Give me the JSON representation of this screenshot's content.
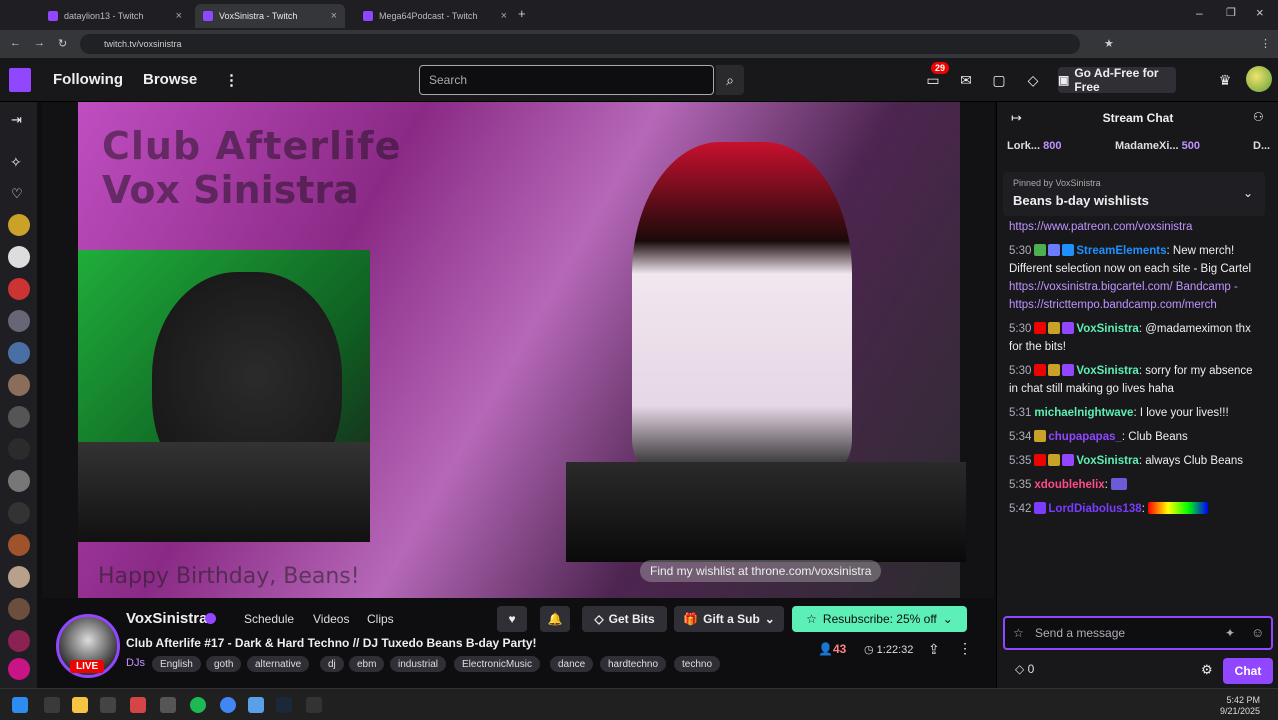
{
  "browser": {
    "tabs": [
      {
        "title": "dataylion13 - Twitch",
        "active": false
      },
      {
        "title": "VoxSinistra - Twitch",
        "active": true
      },
      {
        "title": "Mega64Podcast - Twitch",
        "active": false
      }
    ],
    "url": "twitch.tv/voxsinistra"
  },
  "topnav": {
    "following": "Following",
    "browse": "Browse",
    "search_placeholder": "Search",
    "notification_count": "29",
    "adfree_label": "Go Ad-Free for Free"
  },
  "video": {
    "overlay_title_line1": "Club Afterlife",
    "overlay_title_line2": "Vox Sinistra",
    "overlay_bottom": "Happy Birthday, Beans!",
    "wishlist_text": "Find my wishlist at throne.com/voxsinistra"
  },
  "channel": {
    "name": "VoxSinistra",
    "live_label": "LIVE",
    "tabs": [
      "Schedule",
      "Videos",
      "Clips"
    ],
    "title": "Club Afterlife #17 - Dark & Hard Techno // DJ Tuxedo Beans B-day Party!",
    "category": "DJs",
    "tags": [
      "English",
      "goth",
      "alternative",
      "dj",
      "ebm",
      "industrial",
      "ElectronicMusic",
      "dance",
      "hardtechno",
      "techno"
    ],
    "get_bits": "Get Bits",
    "gift_sub": "Gift a Sub",
    "resubscribe": "Resubscribe: 25% off",
    "viewers": "43",
    "uptime": "1:22:32"
  },
  "chat": {
    "header": "Stream Chat",
    "leaderboard": [
      {
        "name": "Lork...",
        "amount": "800"
      },
      {
        "name": "MadameXi...",
        "amount": "500"
      },
      {
        "name": "D...",
        "amount": ""
      }
    ],
    "pinned_by_label": "Pinned by",
    "pinned_by_user": "VoxSinistra",
    "pinned_text": "Beans b-day wishlists",
    "messages": [
      {
        "time": "",
        "user": "",
        "color": "#bf94ff",
        "text": "",
        "link": "https://www.patreon.com/voxsinistra"
      },
      {
        "time": "5:30",
        "user": "StreamElements",
        "color": "#1e90ff",
        "text": "New merch! Different selection now on each site - Big Cartel",
        "link": "https://voxsinistra.bigcartel.com/ Bandcamp - https://stricttempo.bandcamp.com/merch"
      },
      {
        "time": "5:30",
        "user": "VoxSinistra",
        "color": "#5cf0b6",
        "text": "@madameximon thx for the bits!",
        "link": ""
      },
      {
        "time": "5:30",
        "user": "VoxSinistra",
        "color": "#5cf0b6",
        "text": "sorry for my absence in chat still making go lives haha",
        "link": ""
      },
      {
        "time": "5:31",
        "user": "michaelnightwave",
        "color": "#5cf0b6",
        "text": "I love your lives!!!",
        "link": ""
      },
      {
        "time": "5:34",
        "user": "chupapapas_",
        "color": "#9146ff",
        "text": "Club Beans",
        "link": ""
      },
      {
        "time": "5:35",
        "user": "VoxSinistra",
        "color": "#5cf0b6",
        "text": "always Club Beans",
        "link": ""
      },
      {
        "time": "5:35",
        "user": "xdoublehelix",
        "color": "#ff4a8d",
        "text": "",
        "link": ""
      },
      {
        "time": "5:42",
        "user": "LordDiabolus138",
        "color": "#7a3cff",
        "text": "",
        "link": ""
      }
    ],
    "input_placeholder": "Send a message",
    "points": "0",
    "chat_button": "Chat"
  },
  "taskbar": {
    "time": "5:42 PM",
    "date": "9/21/2025"
  }
}
